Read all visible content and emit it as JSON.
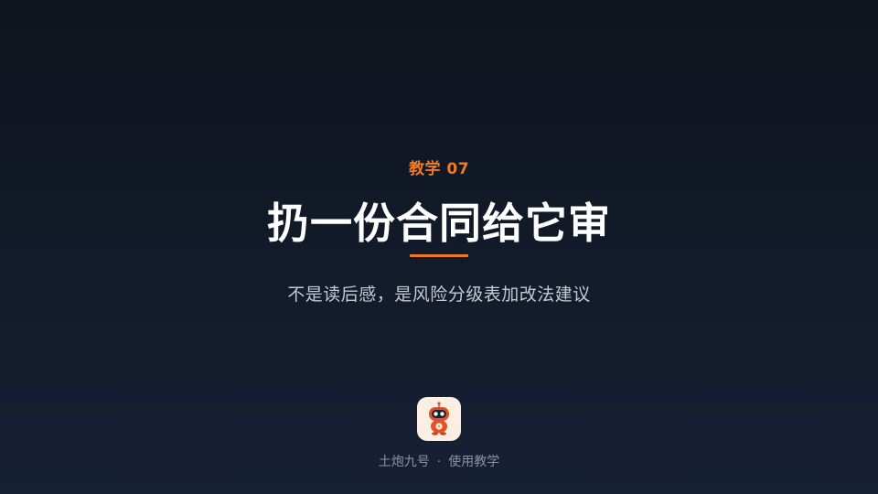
{
  "slide": {
    "eyebrow": "教学 07",
    "title": "扔一份合同给它审",
    "subtitle": "不是读后感，是风险分级表加改法建议",
    "footer": {
      "brand": "土炮九号",
      "separator": "·",
      "section": "使用教学"
    },
    "app_icon": "robot-mascot-icon",
    "colors": {
      "accent": "#f07a24",
      "background_top": "#0f141d",
      "background_bottom": "#172134",
      "title": "#ffffff",
      "subtitle": "#c4cad3",
      "footer": "#8a93a2"
    }
  }
}
